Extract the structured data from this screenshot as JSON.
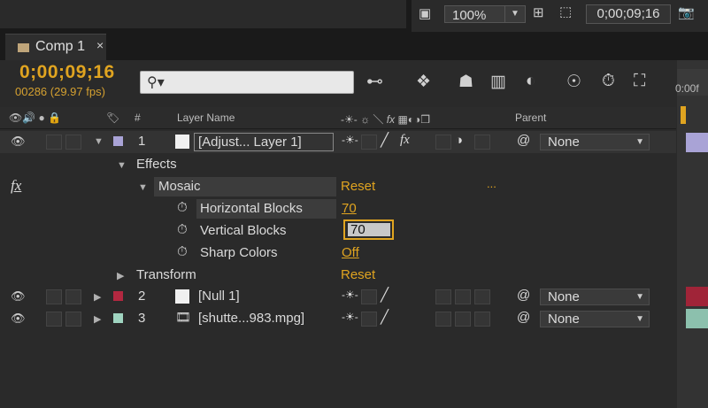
{
  "toolbar": {
    "zoom": "100%",
    "timecode": "0;00;09;16"
  },
  "tab": {
    "label": "Comp 1",
    "close": "×"
  },
  "timeline": {
    "timecode": "0;00;09;16",
    "frames": "00286 (29.97 fps)",
    "search_placeholder": "",
    "ruler_label": "0:00f"
  },
  "columns": {
    "num": "#",
    "layer_name": "Layer Name",
    "parent": "Parent"
  },
  "layers": [
    {
      "num": "1",
      "name": "[Adjust... Layer 1]",
      "label_color": "#a9a3d6",
      "parent": "None"
    },
    {
      "num": "2",
      "name": "[Null 1]",
      "label_color": "#b22840",
      "parent": "None"
    },
    {
      "num": "3",
      "name": "[shutte...983.mpg]",
      "label_color": "#9fd4c0",
      "parent": "None"
    }
  ],
  "effects": {
    "group": "Effects",
    "fx": "fx",
    "effect_name": "Mosaic",
    "reset": "Reset",
    "dots": "...",
    "properties": [
      {
        "name": "Horizontal Blocks",
        "value": "70"
      },
      {
        "name": "Vertical Blocks",
        "value": "70"
      },
      {
        "name": "Sharp Colors",
        "value": "Off"
      }
    ]
  },
  "transform": {
    "label": "Transform",
    "reset": "Reset"
  },
  "colors": {
    "accent": "#e0a420",
    "panel": "#2a2a2a"
  }
}
